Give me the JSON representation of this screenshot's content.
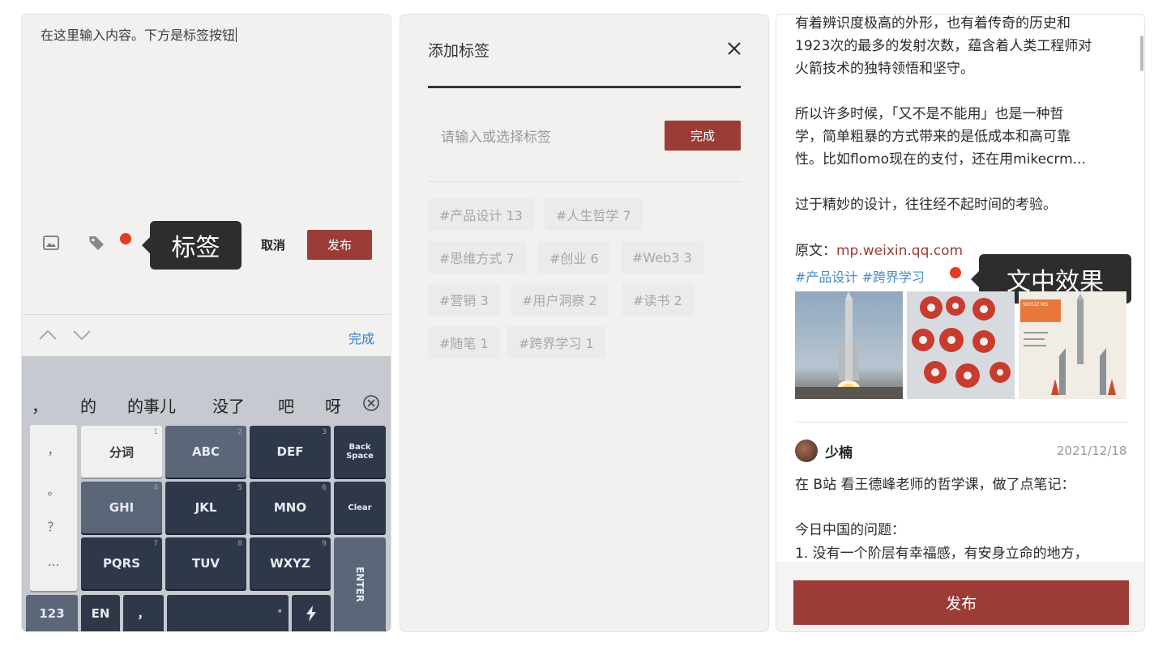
{
  "compose": {
    "text": "在这里输入内容。下方是标签按钮",
    "cancel_label": "取消",
    "publish_label": "发布",
    "callout_label": "标签",
    "icons": [
      "image-icon",
      "tag-icon"
    ]
  },
  "keyboard": {
    "done_label": "完成",
    "candidates": [
      "，",
      "的",
      "的事儿",
      "没了",
      "吧",
      "呀"
    ],
    "keys": {
      "fenci": "分词",
      "abc": "ABC",
      "def": "DEF",
      "back1": "Back",
      "back2": "Space",
      "ghi": "GHI",
      "jkl": "JKL",
      "mno": "MNO",
      "clear": "Clear",
      "pqrs": "PQRS",
      "tuv": "TUV",
      "wxyz": "WXYZ",
      "enter": "ENTER",
      "n123": "123",
      "en": "EN",
      "s1": "1",
      "s2": "2",
      "s3": "3",
      "s4": "4",
      "s5": "5",
      "s6": "6",
      "s7": "7",
      "s8": "8",
      "s9": "9"
    },
    "punct": [
      "，",
      "。",
      "？",
      "…"
    ],
    "space_dot": "°",
    "comma_key": "，"
  },
  "tag_dialog": {
    "title": "添加标签",
    "input_placeholder": "请输入或选择标签",
    "done_label": "完成",
    "tags": [
      "#产品设计 13",
      "#人生哲学 7",
      "#思维方式 7",
      "#创业 6",
      "#Web3 3",
      "#营销 3",
      "#用户洞察 2",
      "#读书 2",
      "#随笔 1",
      "#跨界学习 1"
    ]
  },
  "article": {
    "lines": [
      "有着辨识度极高的外形，也有着传奇的历史和",
      "1923次的最多的发射次数，蕴含着人类工程师对",
      "火箭技术的独特领悟和坚守。",
      "所以许多时候，「又不是不能用」也是一种哲",
      "学，简单粗暴的方式带来的是低成本和高可靠",
      "性。比如flomo现在的支付，还在用mikecrm...",
      "过于精妙的设计，往往经不起时间的考验。"
    ],
    "source_label": "原文：",
    "source_link": "mp.weixin.qq.com",
    "tags_line": "#产品设计 #跨界学习",
    "callout_label": "文中效果",
    "photo3_caption": "SOYUZ MS",
    "memo": {
      "username": "少楠",
      "date": "2021/12/18",
      "lines": [
        "在 B站 看王德峰老师的哲学课，做了点笔记：",
        "今日中国的问题：",
        "1. 没有一个阶层有幸福感，有安身立命的地方，"
      ]
    },
    "publish_label": "发布"
  },
  "colors": {
    "accent": "#9b3d36",
    "dot": "#e53a24",
    "link": "#4a88c7",
    "callout": "#2d2d2d"
  }
}
